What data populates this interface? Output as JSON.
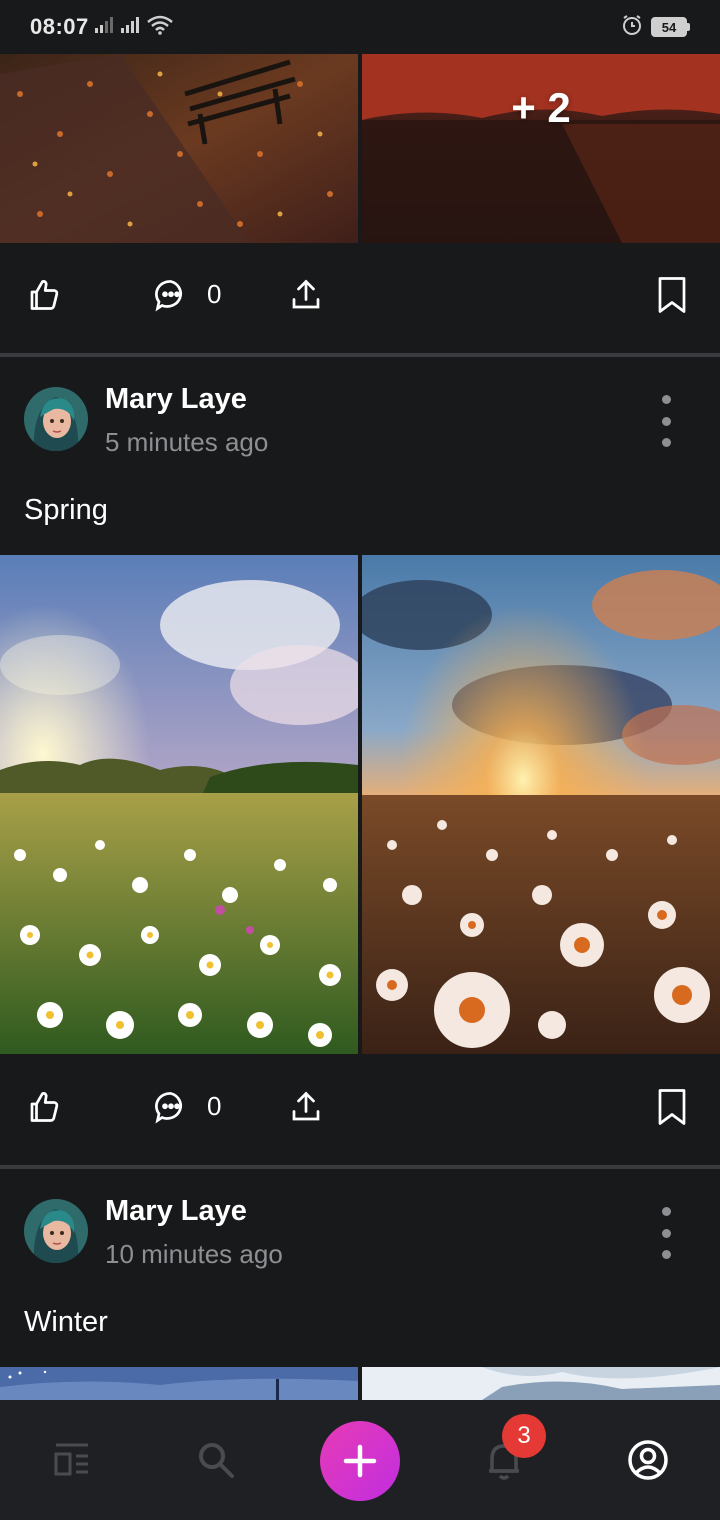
{
  "status_bar": {
    "time": "08:07",
    "battery": "54",
    "icons": [
      "signal-icon",
      "signal-icon",
      "wifi-icon",
      "alarm-icon",
      "battery-icon"
    ]
  },
  "top_post": {
    "more_images_label": "+ 2",
    "comment_count": "0"
  },
  "posts": [
    {
      "author": "Mary Laye",
      "time": "5 minutes ago",
      "text": "Spring",
      "comment_count": "0"
    },
    {
      "author": "Mary Laye",
      "time": "10 minutes ago",
      "text": "Winter"
    }
  ],
  "bottom_nav": {
    "items": [
      "feed-icon",
      "search-icon",
      "add-icon",
      "bell-icon",
      "profile-icon"
    ],
    "notification_count": "3",
    "accent": "#d63adf",
    "badge_color": "#e53935"
  }
}
